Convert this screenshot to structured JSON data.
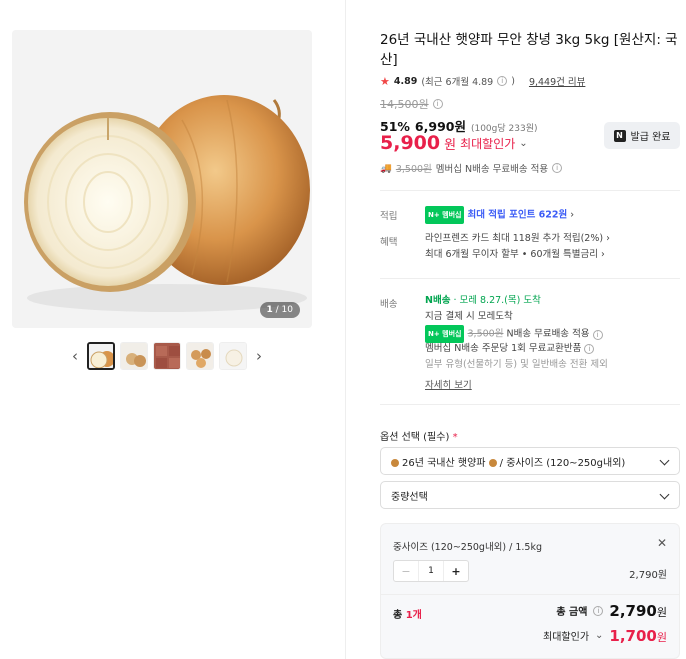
{
  "gallery": {
    "counter_current": "1",
    "counter_total": "/ 10",
    "prev_icon": "chevron-left-icon",
    "next_icon": "chevron-right-icon"
  },
  "product": {
    "title": "26년 국내산 햇양파 무안 창녕 3kg 5kg [원산지: 국산]",
    "rating": "4.89",
    "rating_recent": "(최근 6개월 4.89",
    "rating_recent_close": ")",
    "reviews": "9,449건 리뷰",
    "original_price": "14,500원",
    "discount_pct": "51%",
    "sale_price": "6,990원",
    "unit_price": "(100g당 233원)",
    "max_price": "5,900",
    "max_price_won": "원",
    "max_label": "최대할인가",
    "coupon_label": "발급 완료",
    "shipping_old": "3,500원",
    "shipping_text": "멤버십 N배송 무료배송 적용"
  },
  "benefits": {
    "points_label": "적립",
    "npay_badge": "N+ 멤버십",
    "points_text": "최대 적립 포인트 622원",
    "perks_label": "혜택",
    "perk1": "라인프렌즈 카드 최대 118원 추가 적립(2%)",
    "perk2": "최대 6개월 무이자 할부 • 60개월 특별금리"
  },
  "delivery": {
    "label": "배송",
    "badge": "N배송",
    "arrival": "· 모레 8.27.(목) 도착",
    "line1": "지금 결제 시 모레도착",
    "member_badge": "N+ 멤버십",
    "old_fee": "3,500원",
    "fee_text": "N배송 무료배송 적용",
    "line3": "멤버십 N배송 주문당 1회 무료교환반품",
    "line4": "일부 유형(선물하기 등) 및 일반배송 전환 제외",
    "more_link": "자세히 보기"
  },
  "options": {
    "label": "옵션 선택 (필수)",
    "required_mark": "*",
    "select1": "26년 국내산 햇양파",
    "select1_suffix": "/ 중사이즈 (120~250g내외)",
    "select2": "중량선택"
  },
  "cart": {
    "item_name": "중사이즈 (120~250g내외) / 1.5kg",
    "quantity": "1",
    "item_price": "2,790원",
    "total_prefix": "총",
    "total_count": "1개",
    "total_label": "총 금액",
    "total_amount": "2,790",
    "total_won": "원",
    "max_total_label": "최대할인가",
    "max_total_amount": "1,700",
    "max_total_won": "원"
  },
  "colors": {
    "accent_red": "#e8204a",
    "npay_green": "#03c75a",
    "member_purple": "#6f5af6",
    "points_blue": "#3c5cf6"
  }
}
